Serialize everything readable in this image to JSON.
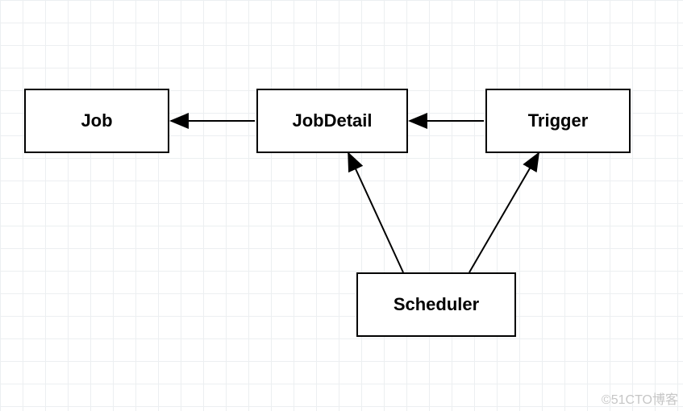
{
  "boxes": {
    "job": {
      "label": "Job"
    },
    "jobDetail": {
      "label": "JobDetail"
    },
    "trigger": {
      "label": "Trigger"
    },
    "scheduler": {
      "label": "Scheduler"
    }
  },
  "watermark": "©51CTO博客",
  "diagram": {
    "nodes": [
      {
        "id": "job",
        "label": "Job"
      },
      {
        "id": "jobDetail",
        "label": "JobDetail"
      },
      {
        "id": "trigger",
        "label": "Trigger"
      },
      {
        "id": "scheduler",
        "label": "Scheduler"
      }
    ],
    "edges": [
      {
        "from": "jobDetail",
        "to": "job"
      },
      {
        "from": "trigger",
        "to": "jobDetail"
      },
      {
        "from": "scheduler",
        "to": "jobDetail"
      },
      {
        "from": "scheduler",
        "to": "trigger"
      }
    ]
  }
}
